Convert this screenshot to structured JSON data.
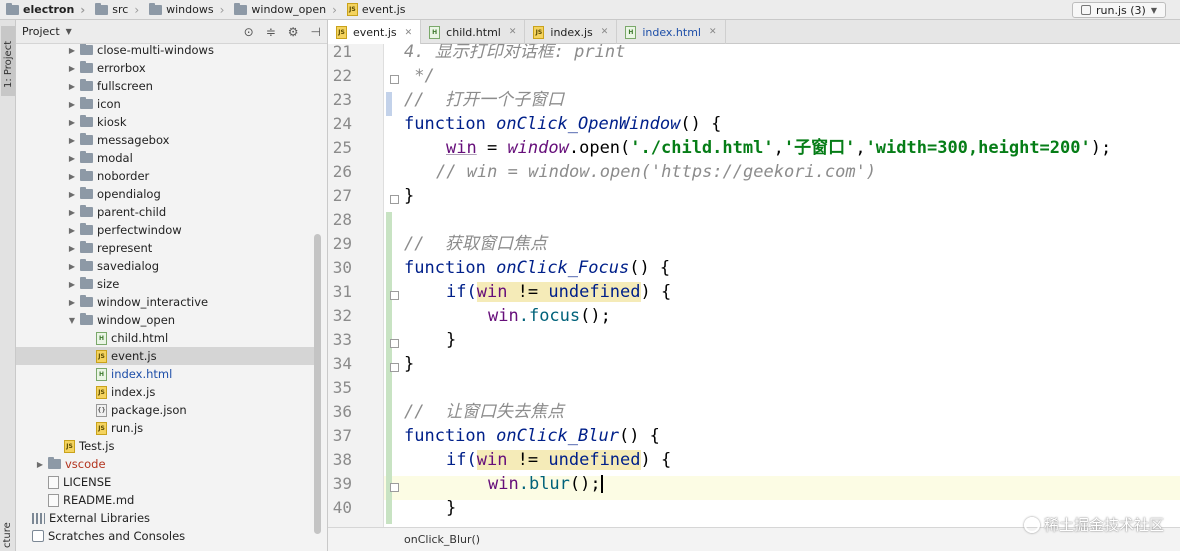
{
  "breadcrumb": [
    "electron",
    "src",
    "windows",
    "window_open",
    "event.js"
  ],
  "run_config": "run.js (3)",
  "side_strip": {
    "project_tab": "1: Project",
    "structure_tab": "cture"
  },
  "project_panel": {
    "title": "Project",
    "items": [
      {
        "label": "close-multi-windows",
        "type": "folder",
        "expanded": false
      },
      {
        "label": "errorbox",
        "type": "folder",
        "expanded": false
      },
      {
        "label": "fullscreen",
        "type": "folder",
        "expanded": false
      },
      {
        "label": "icon",
        "type": "folder",
        "expanded": false
      },
      {
        "label": "kiosk",
        "type": "folder",
        "expanded": false
      },
      {
        "label": "messagebox",
        "type": "folder",
        "expanded": false
      },
      {
        "label": "modal",
        "type": "folder",
        "expanded": false
      },
      {
        "label": "noborder",
        "type": "folder",
        "expanded": false
      },
      {
        "label": "opendialog",
        "type": "folder",
        "expanded": false
      },
      {
        "label": "parent-child",
        "type": "folder",
        "expanded": false
      },
      {
        "label": "perfectwindow",
        "type": "folder",
        "expanded": false
      },
      {
        "label": "represent",
        "type": "folder",
        "expanded": false
      },
      {
        "label": "savedialog",
        "type": "folder",
        "expanded": false
      },
      {
        "label": "size",
        "type": "folder",
        "expanded": false
      },
      {
        "label": "window_interactive",
        "type": "folder",
        "expanded": false
      },
      {
        "label": "window_open",
        "type": "folder",
        "expanded": true
      },
      {
        "label": "child.html",
        "type": "html"
      },
      {
        "label": "event.js",
        "type": "js",
        "selected": true
      },
      {
        "label": "index.html",
        "type": "html",
        "modified": true
      },
      {
        "label": "index.js",
        "type": "js"
      },
      {
        "label": "package.json",
        "type": "json"
      },
      {
        "label": "run.js",
        "type": "js"
      },
      {
        "label": "Test.js",
        "type": "js"
      },
      {
        "label": "vscode",
        "type": "folder",
        "expanded": false,
        "excluded": true
      },
      {
        "label": "LICENSE",
        "type": "txt"
      },
      {
        "label": "README.md",
        "type": "txt"
      },
      {
        "label": "External Libraries",
        "type": "lib"
      },
      {
        "label": "Scratches and Consoles",
        "type": "scratch"
      }
    ]
  },
  "tabs": [
    {
      "label": "event.js",
      "type": "js",
      "active": true
    },
    {
      "label": "child.html",
      "type": "html"
    },
    {
      "label": "index.js",
      "type": "js"
    },
    {
      "label": "index.html",
      "type": "html"
    }
  ],
  "editor": {
    "line_numbers": [
      "21",
      "22",
      "23",
      "24",
      "25",
      "26",
      "27",
      "28",
      "29",
      "30",
      "31",
      "32",
      "33",
      "34",
      "35",
      "36",
      "37",
      "38",
      "39",
      "40"
    ],
    "code": {
      "l21": "4. 显示打印对话框: print",
      "l22": " */",
      "l23": "//  打开一个子窗口",
      "l24_kw": "function",
      "l24_fn": "onClick_OpenWindow",
      "l24_rest": "() {",
      "l25_var": "win",
      "l25_eq": " = ",
      "l25_obj": "window",
      "l25_call": ".open(",
      "l25_s1": "'./child.html'",
      "l25_s2": "'子窗口'",
      "l25_s3": "'width=300,height=200'",
      "l25_end": ");",
      "l26": "// win = window.open('https://geekori.com')",
      "l27": "}",
      "l29": "//  获取窗口焦点",
      "l30_kw": "function",
      "l30_fn": "onClick_Focus",
      "l30_rest": "() {",
      "cond_if": "if(",
      "cond_win": "win",
      "cond_ne": " != ",
      "cond_undef": "undefined",
      "cond_end": ") {",
      "l32_win": "win",
      "l32_call": ".focus",
      "l32_end": "();",
      "l33": "}",
      "l34": "}",
      "l36": "//  让窗口失去焦点",
      "l37_kw": "function",
      "l37_fn": "onClick_Blur",
      "l37_rest": "() {",
      "l39_win": "win",
      "l39_call": ".blur",
      "l39_end": "();",
      "l40": "}"
    }
  },
  "status_breadcrumb": "onClick_Blur()",
  "watermark": "稀土掘金技术社区"
}
